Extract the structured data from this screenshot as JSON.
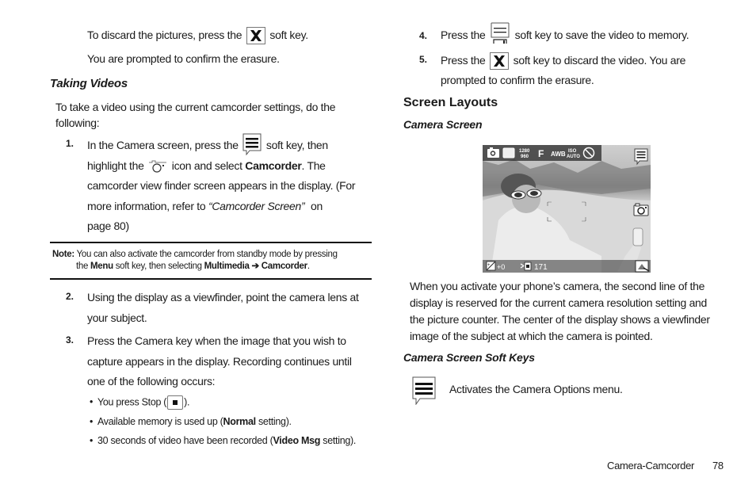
{
  "left_column": {
    "discard_line_pre": "To discard the pictures, press the",
    "discard_line_post": "soft key.",
    "confirm_line": "You are prompted to confirm the erasure.",
    "taking_videos_heading": "Taking Videos",
    "intro": "To take a video using the current camcorder settings, do the following:",
    "intro_line1": "To take a video using the current camcorder settings, do the",
    "intro_line2": "following:",
    "step1": {
      "number": "1.",
      "line1_pre": "In the Camera screen, press the",
      "line1_post": "soft key, then",
      "line2_pre": "highlight the",
      "line2_mid": "icon and select",
      "line2_bold": "Camcorder",
      "line2_post": ". The",
      "line3": "camcorder view finder screen appears in the display. (For",
      "line4_pre": "more information, refer to",
      "line4_italic": "“Camcorder Screen”",
      "line4_post": "on",
      "line5": "page 80)"
    },
    "note": {
      "label": "Note:",
      "line1": "You can also activate the camcorder from standby mode by pressing",
      "line2_pre": "the",
      "line2_menu": "Menu",
      "line2_mid": "soft key, then selecting",
      "line2_multimedia": "Multimedia",
      "line2_arrow": "➔",
      "line2_camcorder": "Camcorder",
      "line2_end": "."
    },
    "step2": {
      "number": "2.",
      "line1": "Using the display as a viewfinder, point the camera lens at",
      "line2": "your subject."
    },
    "step3": {
      "number": "3.",
      "line1": "Press the Camera key when the image that you wish to",
      "line2": "capture appears in the display. Recording continues until",
      "line3": "one of the following occurs:"
    },
    "bullets": [
      {
        "pre": "You press Stop (",
        "icon": "stop-icon",
        "post": ")."
      },
      {
        "pre": "Available memory is used up (",
        "bold": "Normal",
        "post": " setting)."
      },
      {
        "pre": "30 seconds of video have been recorded (",
        "bold": "Video Msg",
        "post": " setting)."
      }
    ]
  },
  "right_column": {
    "step4": {
      "number": "4.",
      "pre": "Press the",
      "post": "soft key to save the video to memory."
    },
    "step5": {
      "number": "5.",
      "pre": "Press the",
      "post": "soft key to discard the video. You are",
      "line2": "prompted to confirm the erasure."
    },
    "screen_layouts_heading": "Screen Layouts",
    "camera_screen_heading": "Camera Screen",
    "camera_screen": {
      "top_indicators": [
        "camera-mode-icon",
        "single-shot-icon",
        "resolution-1280x960-icon",
        "quality-fine-icon",
        "white-balance-auto-icon",
        "iso-auto-icon",
        "night-off-icon"
      ],
      "resolution_text_top": "1280",
      "resolution_text_bottom": "960",
      "quality_text": "F",
      "wb_text": "AWB",
      "iso_text_top": "ISO",
      "iso_text_bottom": "AUTO",
      "exposure_value": "+0",
      "counter_value": "171"
    },
    "description": [
      "When you activate your phone’s camera, the second line of the",
      "display is reserved for the current camera resolution setting and",
      "the picture counter. The center of the display shows a viewfinder",
      "image of the subject at which the camera is pointed."
    ],
    "soft_keys_heading": "Camera Screen Soft Keys",
    "soft_keys": [
      {
        "icon": "menu-softkey-icon",
        "description": "Activates the Camera Options menu."
      }
    ]
  },
  "footer": {
    "section": "Camera-Camcorder",
    "page_number": "78"
  }
}
